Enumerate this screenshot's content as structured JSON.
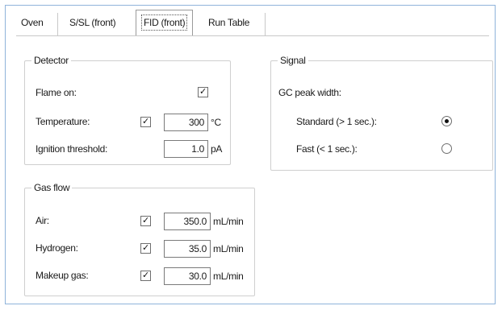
{
  "tabs": [
    {
      "label": "Oven",
      "selected": false
    },
    {
      "label": "S/SL (front)",
      "selected": false
    },
    {
      "label": "FID (front)",
      "selected": true
    },
    {
      "label": "Run Table",
      "selected": false
    }
  ],
  "detector": {
    "title": "Detector",
    "flame_label": "Flame on:",
    "flame_checked": true,
    "temperature_label": "Temperature:",
    "temperature_checked": true,
    "temperature_value": "300",
    "temperature_unit": "°C",
    "ignition_label": "Ignition threshold:",
    "ignition_value": "1.0",
    "ignition_unit": "pA"
  },
  "signal": {
    "title": "Signal",
    "peak_width_label": "GC peak width:",
    "options": [
      {
        "label": "Standard (> 1 sec.):",
        "selected": true
      },
      {
        "label": "Fast (< 1 sec.):",
        "selected": false
      }
    ]
  },
  "gas_flow": {
    "title": "Gas flow",
    "rows": [
      {
        "label": "Air:",
        "checked": true,
        "value": "350.0",
        "unit": "mL/min"
      },
      {
        "label": "Hydrogen:",
        "checked": true,
        "value": "35.0",
        "unit": "mL/min"
      },
      {
        "label": "Makeup gas:",
        "checked": true,
        "value": "30.0",
        "unit": "mL/min"
      }
    ]
  },
  "icons": {
    "check_glyph": "✓"
  }
}
